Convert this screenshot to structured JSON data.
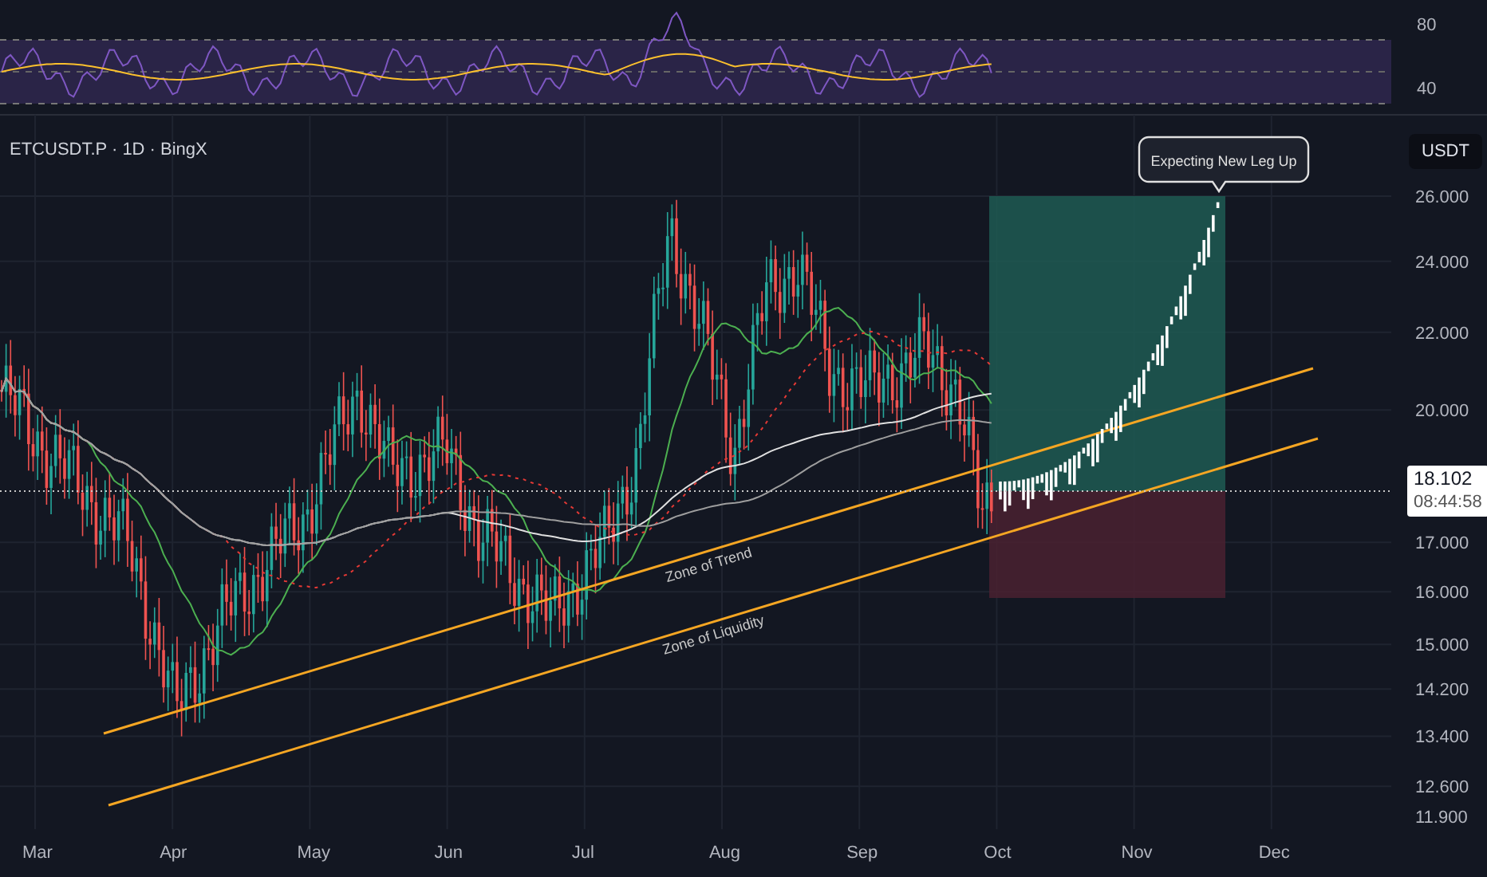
{
  "symbol_title": "ETCUSDT.P · 1D · BingX",
  "rsi_pane": {
    "axis_labels": [
      "80",
      "40"
    ]
  },
  "price_axis": {
    "currency": "USDT",
    "labels": [
      "26.000",
      "24.000",
      "22.000",
      "20.000",
      "17.000",
      "16.000",
      "15.000",
      "14.200",
      "13.400",
      "12.600",
      "11.900"
    ],
    "last_price": {
      "price": "18.102",
      "countdown": "08:44:58"
    }
  },
  "annotations": [
    {
      "kind": "callout",
      "text": "Expecting New Leg Up"
    },
    {
      "kind": "trendline_label",
      "text": "Zone of Trend"
    },
    {
      "kind": "trendline_label",
      "text": "Zone of Liquidity"
    }
  ],
  "time_axis": [
    "Mar",
    "Apr",
    "May",
    "Jun",
    "Jul",
    "Aug",
    "Sep",
    "Oct",
    "Nov",
    "Dec"
  ]
}
